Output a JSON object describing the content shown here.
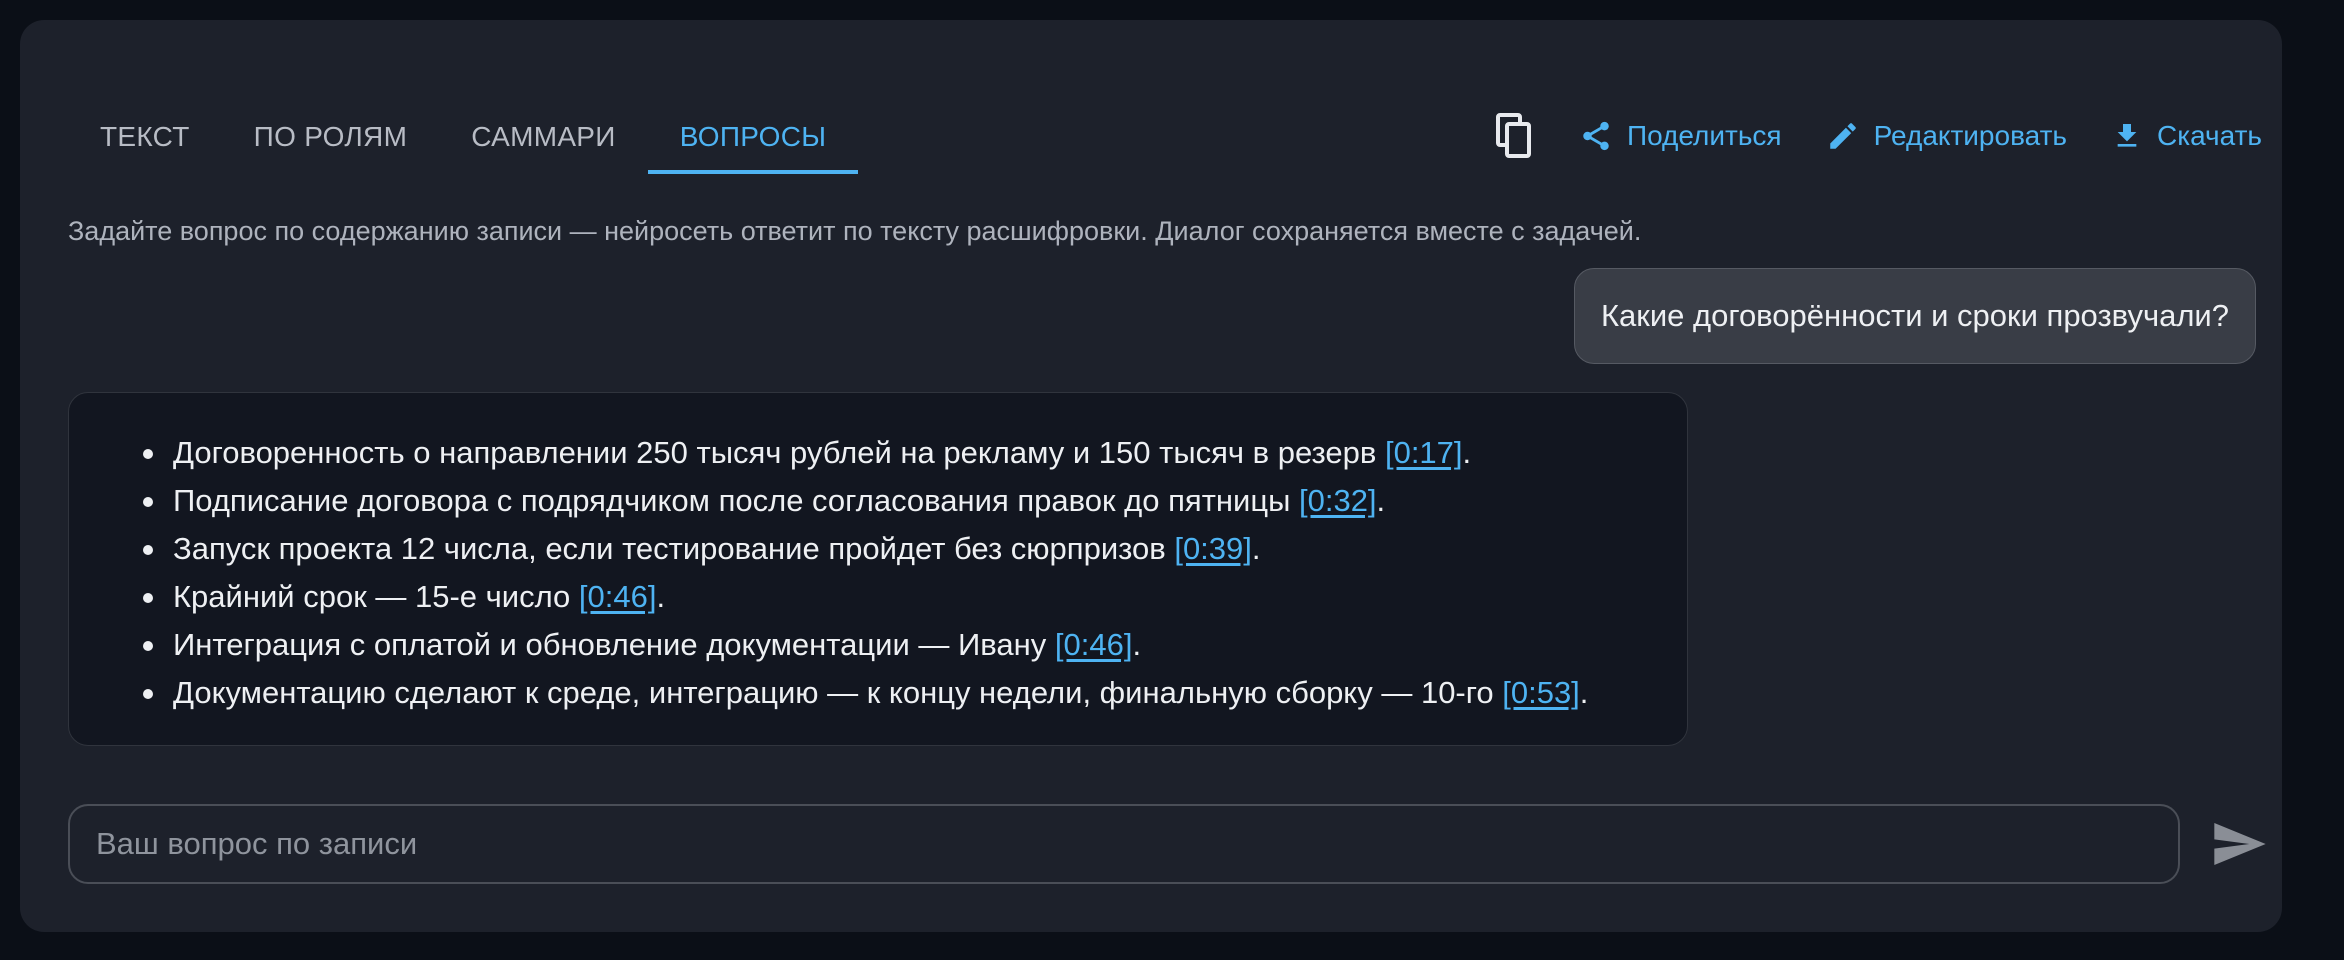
{
  "tabs": [
    {
      "label": "ТЕКСТ"
    },
    {
      "label": "ПО РОЛЯМ"
    },
    {
      "label": "САММАРИ"
    },
    {
      "label": "ВОПРОСЫ",
      "active": true
    }
  ],
  "actions": {
    "copy_icon": "copy-icon",
    "share_label": "Поделиться",
    "edit_label": "Редактировать",
    "download_label": "Скачать"
  },
  "hint": "Задайте вопрос по содержанию записи — нейросеть ответит по тексту расшифровки. Диалог сохраняется вместе с задачей.",
  "question": "Какие договорённости и сроки прозвучали?",
  "answer": [
    {
      "text": "Договоренность о направлении 250 тысяч рублей на рекламу и 150 тысяч в резерв ",
      "ts": "[0:17]"
    },
    {
      "text": "Подписание договора с подрядчиком после согласования правок до пятницы ",
      "ts": "[0:32]"
    },
    {
      "text": "Запуск проекта 12 числа, если тестирование пройдет без сюрпризов ",
      "ts": "[0:39]"
    },
    {
      "text": "Крайний срок — 15-е число ",
      "ts": "[0:46]"
    },
    {
      "text": "Интеграция с оплатой и обновление документации — Ивану ",
      "ts": "[0:46]"
    },
    {
      "text": "Документацию сделают к среде, интеграцию — к концу недели, финальную сборку — 10-го ",
      "ts": "[0:53]"
    }
  ],
  "input": {
    "placeholder": "Ваш вопрос по записи",
    "value": ""
  },
  "colors": {
    "accent": "#4eb3f2",
    "card": "#1d212b",
    "background": "#0b0f17"
  }
}
